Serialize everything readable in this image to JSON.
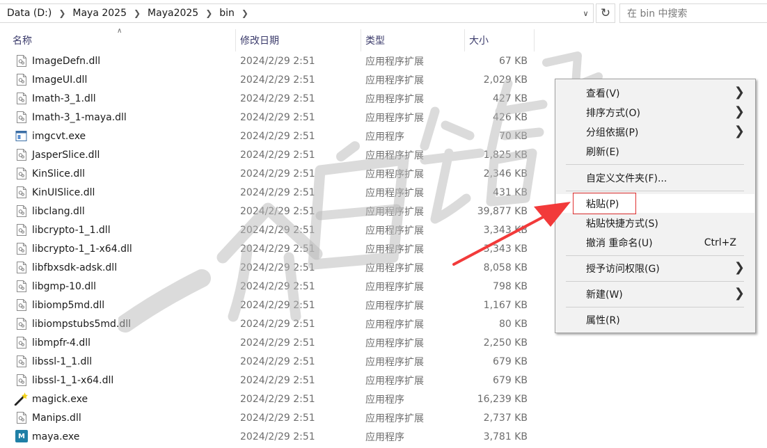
{
  "address_bar": {
    "breadcrumbs": [
      "Data (D:)",
      "Maya 2025",
      "Maya2025",
      "bin"
    ],
    "separator_icon": "chevron-right-icon",
    "dropdown_icon": "chevron-down-icon",
    "refresh_icon": "refresh-icon",
    "search_placeholder": "在 bin 中搜索"
  },
  "columns": {
    "name": "名称",
    "date": "修改日期",
    "type": "类型",
    "size": "大小",
    "sort_icon": "sort-ascending-icon"
  },
  "files": [
    {
      "name": "ImageDefn.dll",
      "date": "2024/2/29 2:51",
      "type": "应用程序扩展",
      "size": "67 KB",
      "icon": "dll-file-icon"
    },
    {
      "name": "ImageUI.dll",
      "date": "2024/2/29 2:51",
      "type": "应用程序扩展",
      "size": "2,029 KB",
      "icon": "dll-file-icon"
    },
    {
      "name": "Imath-3_1.dll",
      "date": "2024/2/29 2:51",
      "type": "应用程序扩展",
      "size": "427 KB",
      "icon": "dll-file-icon"
    },
    {
      "name": "Imath-3_1-maya.dll",
      "date": "2024/2/29 2:51",
      "type": "应用程序扩展",
      "size": "426 KB",
      "icon": "dll-file-icon"
    },
    {
      "name": "imgcvt.exe",
      "date": "2024/2/29 2:51",
      "type": "应用程序",
      "size": "70 KB",
      "icon": "exe-window-icon"
    },
    {
      "name": "JasperSlice.dll",
      "date": "2024/2/29 2:51",
      "type": "应用程序扩展",
      "size": "1,825 KB",
      "icon": "dll-file-icon"
    },
    {
      "name": "KinSlice.dll",
      "date": "2024/2/29 2:51",
      "type": "应用程序扩展",
      "size": "2,346 KB",
      "icon": "dll-file-icon"
    },
    {
      "name": "KinUISlice.dll",
      "date": "2024/2/29 2:51",
      "type": "应用程序扩展",
      "size": "431 KB",
      "icon": "dll-file-icon"
    },
    {
      "name": "libclang.dll",
      "date": "2024/2/29 2:51",
      "type": "应用程序扩展",
      "size": "39,877 KB",
      "icon": "dll-file-icon"
    },
    {
      "name": "libcrypto-1_1.dll",
      "date": "2024/2/29 2:51",
      "type": "应用程序扩展",
      "size": "3,343 KB",
      "icon": "dll-file-icon"
    },
    {
      "name": "libcrypto-1_1-x64.dll",
      "date": "2024/2/29 2:51",
      "type": "应用程序扩展",
      "size": "3,343 KB",
      "icon": "dll-file-icon"
    },
    {
      "name": "libfbxsdk-adsk.dll",
      "date": "2024/2/29 2:51",
      "type": "应用程序扩展",
      "size": "8,058 KB",
      "icon": "dll-file-icon"
    },
    {
      "name": "libgmp-10.dll",
      "date": "2024/2/29 2:51",
      "type": "应用程序扩展",
      "size": "798 KB",
      "icon": "dll-file-icon"
    },
    {
      "name": "libiomp5md.dll",
      "date": "2024/2/29 2:51",
      "type": "应用程序扩展",
      "size": "1,167 KB",
      "icon": "dll-file-icon"
    },
    {
      "name": "libiompstubs5md.dll",
      "date": "2024/2/29 2:51",
      "type": "应用程序扩展",
      "size": "80 KB",
      "icon": "dll-file-icon"
    },
    {
      "name": "libmpfr-4.dll",
      "date": "2024/2/29 2:51",
      "type": "应用程序扩展",
      "size": "2,250 KB",
      "icon": "dll-file-icon"
    },
    {
      "name": "libssl-1_1.dll",
      "date": "2024/2/29 2:51",
      "type": "应用程序扩展",
      "size": "679 KB",
      "icon": "dll-file-icon"
    },
    {
      "name": "libssl-1_1-x64.dll",
      "date": "2024/2/29 2:51",
      "type": "应用程序扩展",
      "size": "679 KB",
      "icon": "dll-file-icon"
    },
    {
      "name": "magick.exe",
      "date": "2024/2/29 2:51",
      "type": "应用程序",
      "size": "16,239 KB",
      "icon": "magic-wand-icon"
    },
    {
      "name": "Manips.dll",
      "date": "2024/2/29 2:51",
      "type": "应用程序扩展",
      "size": "2,737 KB",
      "icon": "dll-file-icon"
    },
    {
      "name": "maya.exe",
      "date": "2024/2/29 2:51",
      "type": "应用程序",
      "size": "3,781 KB",
      "icon": "maya-app-icon"
    }
  ],
  "context_menu": {
    "items": [
      {
        "label": "查看(V)",
        "submenu": true
      },
      {
        "label": "排序方式(O)",
        "submenu": true
      },
      {
        "label": "分组依据(P)",
        "submenu": true
      },
      {
        "label": "刷新(E)",
        "submenu": false
      },
      {
        "label": "自定义文件夹(F)...",
        "submenu": false
      },
      {
        "label": "粘贴(P)",
        "submenu": false,
        "highlighted": true
      },
      {
        "label": "粘贴快捷方式(S)",
        "submenu": false
      },
      {
        "label": "撤消 重命名(U)",
        "submenu": false,
        "shortcut": "Ctrl+Z"
      },
      {
        "label": "授予访问权限(G)",
        "submenu": true
      },
      {
        "label": "新建(W)",
        "submenu": true
      },
      {
        "label": "属性(R)",
        "submenu": false
      }
    ],
    "submenu_icon": "chevron-right-icon"
  },
  "annotation": {
    "highlight_color": "#e03030",
    "arrow_color": "#f23a3a"
  },
  "colors": {
    "header_text": "#3b3b6b",
    "secondary_text": "#6d6d6d",
    "menu_background": "#f2f2f2"
  }
}
